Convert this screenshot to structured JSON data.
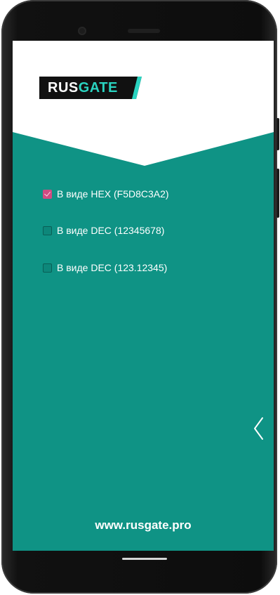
{
  "app": {
    "logo": {
      "part1": "RUS",
      "part2": "GATE"
    }
  },
  "options": [
    {
      "label": "В виде HEX (F5D8C3A2)",
      "checked": true
    },
    {
      "label": "В виде DEC (12345678)",
      "checked": false
    },
    {
      "label": "В виде DEC (123.12345)",
      "checked": false
    }
  ],
  "footer": {
    "url": "www.rusgate.pro"
  },
  "colors": {
    "teal": "#0f9385",
    "accent": "#2ad3c0",
    "checkbox_checked": "#d14b82",
    "logo_background": "#111111"
  },
  "icons": {
    "back": "chevron-left-icon",
    "check": "checkmark-icon"
  }
}
